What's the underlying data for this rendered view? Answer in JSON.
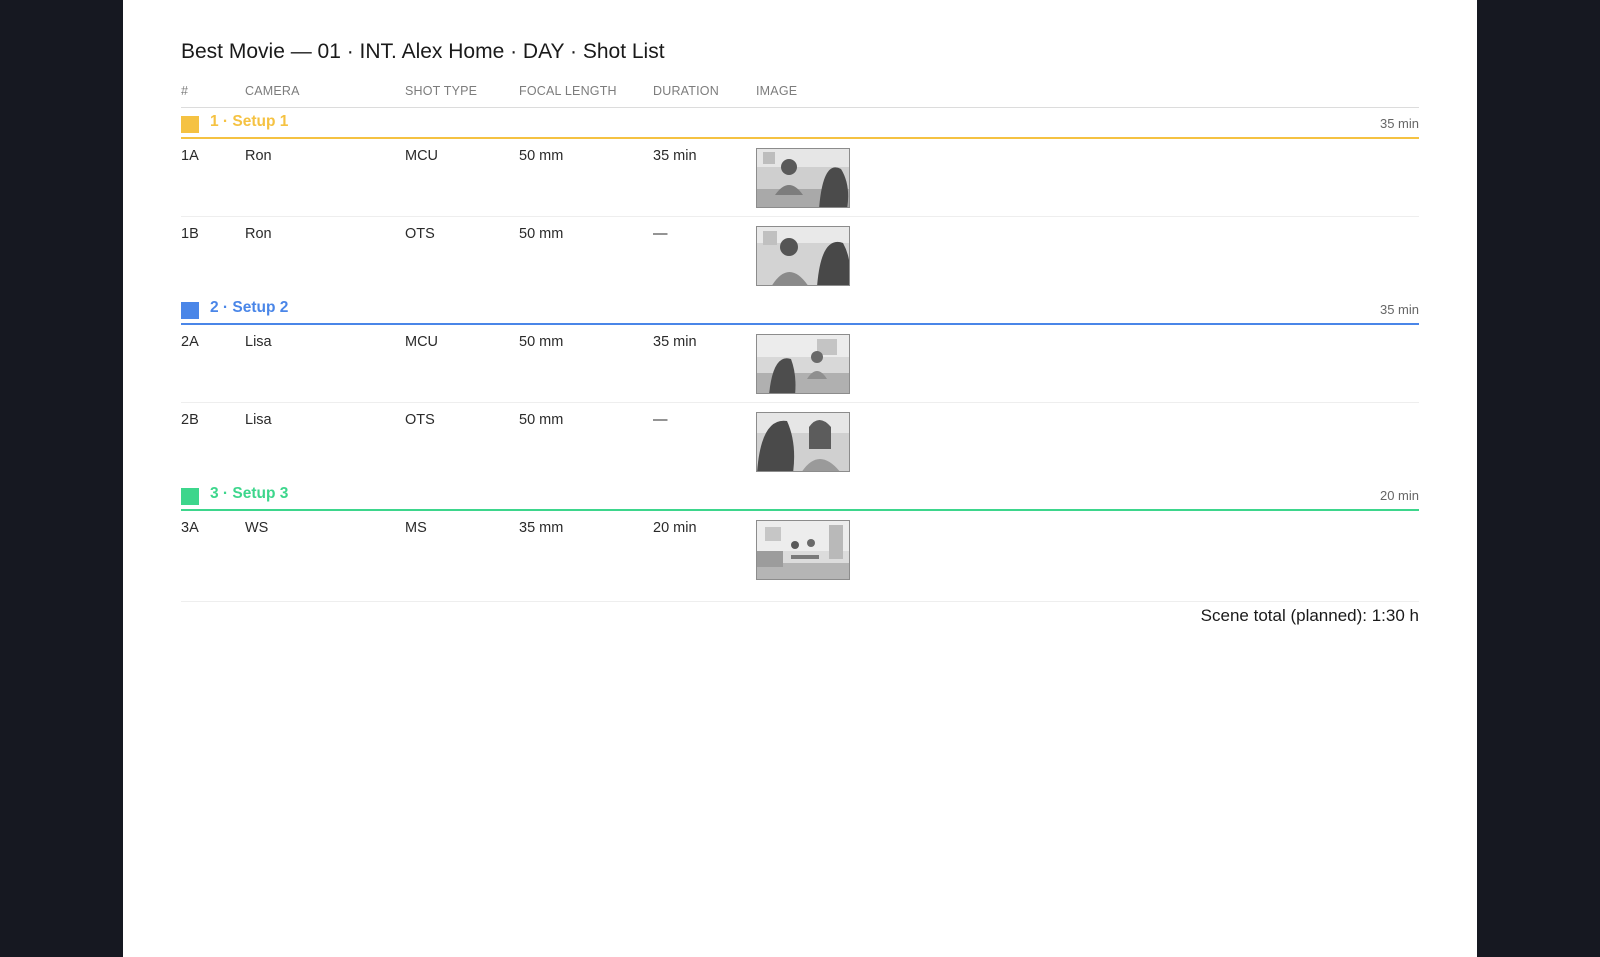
{
  "document": {
    "title": "Best Movie — 01 · INT. Alex Home · DAY · Shot List"
  },
  "columns": {
    "number": "#",
    "camera": "CAMERA",
    "shot_type": "SHOT TYPE",
    "focal_length": "FOCAL LENGTH",
    "duration": "DURATION",
    "image": "IMAGE"
  },
  "setups": [
    {
      "label": "1 · Setup 1",
      "total": "35 min",
      "color": "#F5C242",
      "shots": [
        {
          "number": "1A",
          "camera": "Ron",
          "shot_type": "MCU",
          "focal_length": "50 mm",
          "duration": "35 min",
          "image": "two-shot-man-facing-woman-back"
        },
        {
          "number": "1B",
          "camera": "Ron",
          "shot_type": "OTS",
          "focal_length": "50 mm",
          "duration": "—",
          "image": "ots-man-facing-camera"
        }
      ]
    },
    {
      "label": "2 · Setup 2",
      "total": "35 min",
      "color": "#4A86E8",
      "shots": [
        {
          "number": "2A",
          "camera": "Lisa",
          "shot_type": "MCU",
          "focal_length": "50 mm",
          "duration": "35 min",
          "image": "wide-man-back-woman-facing"
        },
        {
          "number": "2B",
          "camera": "Lisa",
          "shot_type": "OTS",
          "focal_length": "50 mm",
          "duration": "—",
          "image": "ots-woman-facing-camera"
        }
      ]
    },
    {
      "label": "3 · Setup 3",
      "total": "20 min",
      "color": "#3DD68C",
      "shots": [
        {
          "number": "3A",
          "camera": "WS",
          "shot_type": "MS",
          "focal_length": "35 mm",
          "duration": "20 min",
          "image": "wide-room-two-people-at-table"
        }
      ]
    }
  ],
  "scene_total": "Scene total (planned): 1:30 h"
}
